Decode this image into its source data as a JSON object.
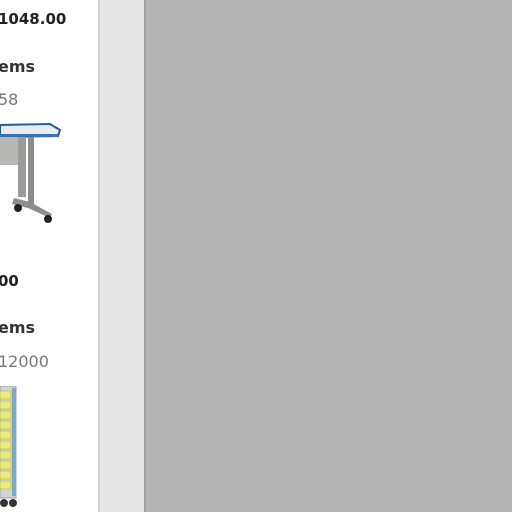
{
  "products": [
    {
      "price": "1048.00",
      "items_label": "ems",
      "code": "58",
      "image": "desk-image"
    },
    {
      "price": "00",
      "items_label": "ems",
      "code": "12000",
      "image": "tray-storage-cart-image"
    }
  ]
}
